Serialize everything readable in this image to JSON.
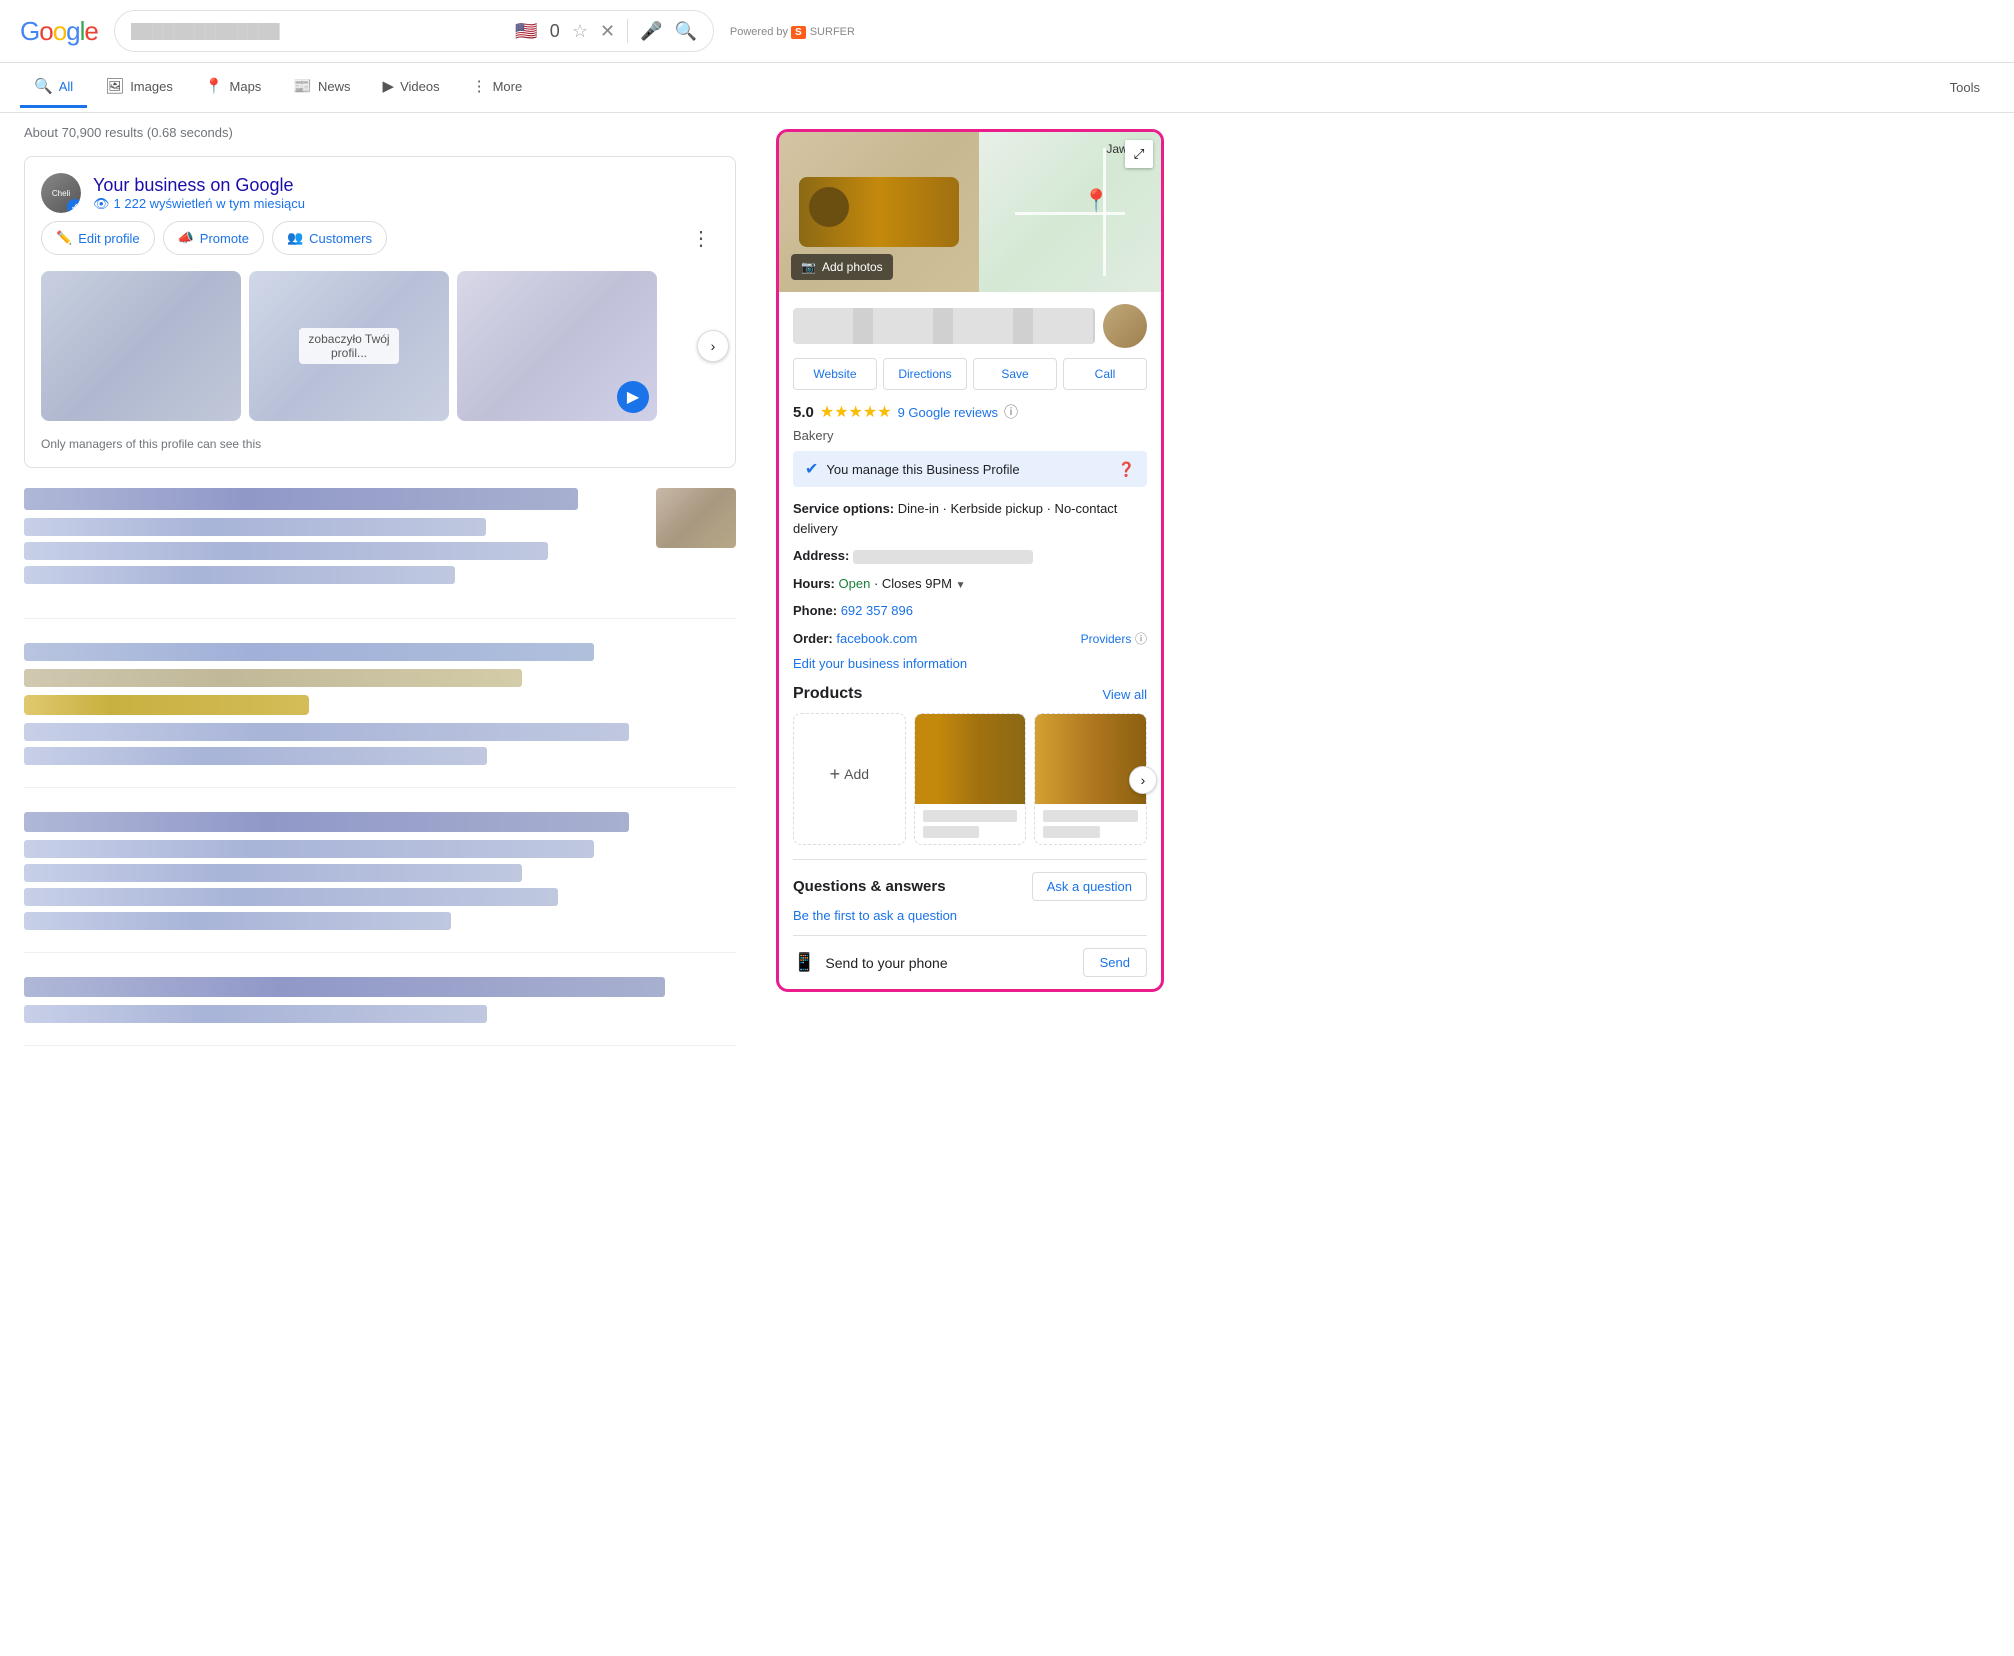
{
  "header": {
    "logo": "Google",
    "search_placeholder": "blurred search text",
    "powered_by": "Powered by",
    "surfer": "SURFER",
    "bookmark_count": "0"
  },
  "nav": {
    "tabs": [
      {
        "id": "all",
        "label": "All",
        "icon": "🔍",
        "active": true
      },
      {
        "id": "images",
        "label": "Images",
        "icon": "🖼"
      },
      {
        "id": "maps",
        "label": "Maps",
        "icon": "📍"
      },
      {
        "id": "news",
        "label": "News",
        "icon": "📰"
      },
      {
        "id": "videos",
        "label": "Videos",
        "icon": "▶"
      },
      {
        "id": "more",
        "label": "More",
        "icon": "⋮"
      }
    ],
    "tools": "Tools",
    "results_count": "About 70,900 results (0.68 seconds)"
  },
  "business_card": {
    "name": "Your business on Google",
    "views": "1 222 wyświetleń w tym miesiącu",
    "views_icon": "👁",
    "actions": [
      {
        "id": "edit",
        "label": "Edit profile",
        "icon": "✏️"
      },
      {
        "id": "promote",
        "label": "Promote",
        "icon": "📣"
      },
      {
        "id": "customers",
        "label": "Customers",
        "icon": "👥"
      }
    ],
    "carousel_label": "zobaczyło Twój profil...",
    "managers_note": "Only managers of this profile can see this"
  },
  "right_panel": {
    "map_location": "Jaworze",
    "add_photos": "Add photos",
    "action_buttons": [
      {
        "id": "website",
        "label": "Website"
      },
      {
        "id": "directions",
        "label": "Directions"
      },
      {
        "id": "save",
        "label": "Save"
      },
      {
        "id": "call",
        "label": "Call"
      }
    ],
    "rating": "5.0",
    "stars_count": 5,
    "reviews": "9 Google reviews",
    "category": "Bakery",
    "manage_text": "You manage this Business Profile",
    "service_label": "Service options:",
    "service_value": "Dine-in · Kerbside pickup · No-contact delivery",
    "address_label": "Address:",
    "hours_label": "Hours:",
    "open_status": "Open",
    "closes": "Closes 9PM",
    "phone_label": "Phone:",
    "phone_number": "692 357 896",
    "order_label": "Order:",
    "order_link": "facebook.com",
    "providers": "Providers",
    "edit_info": "Edit your business information",
    "products_title": "Products",
    "view_all": "View all",
    "add_label": "Add",
    "qa_title": "Questions & answers",
    "qa_link": "Be the first to ask a question",
    "ask_btn": "Ask a question",
    "send_label": "Send to your phone",
    "send_btn": "Send"
  }
}
